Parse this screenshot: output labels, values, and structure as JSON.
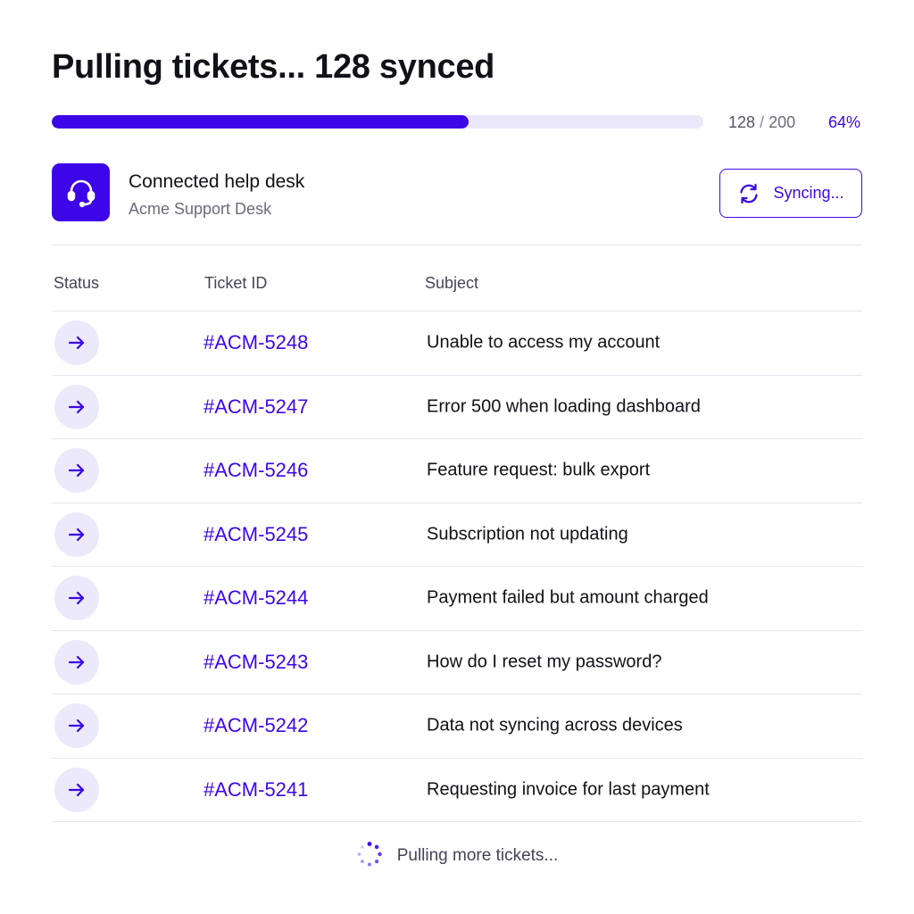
{
  "header": {
    "title": "Pulling tickets... 128 synced"
  },
  "progress": {
    "synced": "128",
    "separator": "/",
    "total": "200",
    "percent_label": "64%",
    "fraction": 0.64
  },
  "connection": {
    "title": "Connected help desk",
    "subtitle": "Acme Support Desk",
    "app_icon": "headset-icon",
    "sync_button_label": "Syncing...",
    "sync_icon": "refresh-icon"
  },
  "table": {
    "columns": [
      "Status",
      "Ticket ID",
      "Subject"
    ],
    "rows": [
      {
        "status_icon": "arrow-right-icon",
        "id": "#ACM-5248",
        "subject": "Unable to access my account"
      },
      {
        "status_icon": "arrow-right-icon",
        "id": "#ACM-5247",
        "subject": "Error 500 when loading dashboard"
      },
      {
        "status_icon": "arrow-right-icon",
        "id": "#ACM-5246",
        "subject": "Feature request: bulk export"
      },
      {
        "status_icon": "arrow-right-icon",
        "id": "#ACM-5245",
        "subject": "Subscription not updating"
      },
      {
        "status_icon": "arrow-right-icon",
        "id": "#ACM-5244",
        "subject": "Payment failed but amount charged"
      },
      {
        "status_icon": "arrow-right-icon",
        "id": "#ACM-5243",
        "subject": "How do I reset my password?"
      },
      {
        "status_icon": "arrow-right-icon",
        "id": "#ACM-5242",
        "subject": "Data not syncing across devices"
      },
      {
        "status_icon": "arrow-right-icon",
        "id": "#ACM-5241",
        "subject": "Requesting invoice for last payment"
      }
    ]
  },
  "footer": {
    "loading_text": "Pulling more tickets...",
    "loading_icon": "spinner-icon"
  },
  "colors": {
    "accent": "#3d06e8",
    "accent_soft": "#ece9fb",
    "track": "#ebe8fb"
  }
}
